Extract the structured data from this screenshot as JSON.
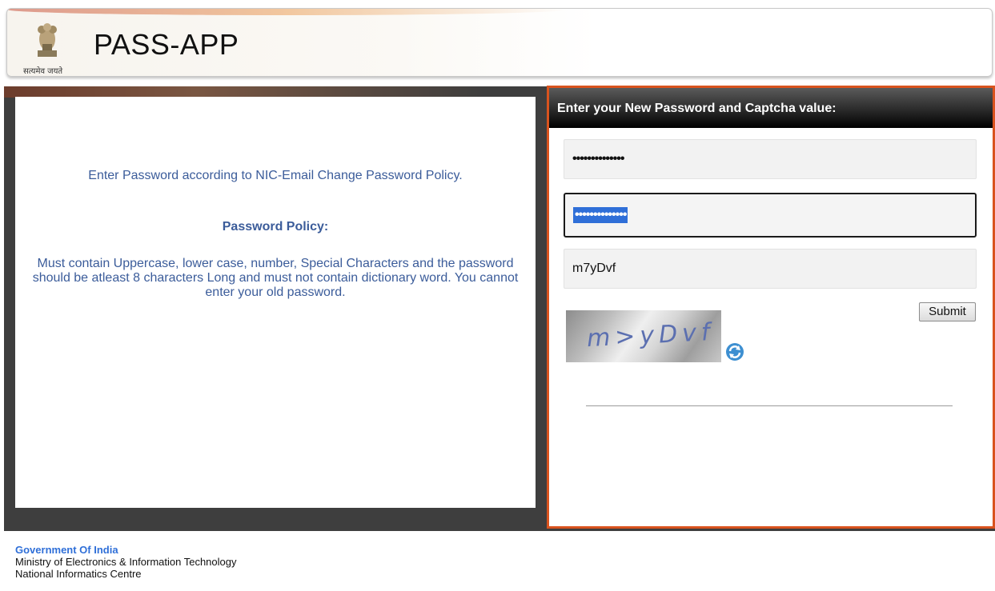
{
  "header": {
    "title": "PASS-APP",
    "emblem_caption": "सत्यमेव जयते"
  },
  "info": {
    "intro": "Enter Password according to NIC-Email Change Password Policy.",
    "policy_heading": "Password Policy:",
    "policy_text": "Must contain Uppercase, lower case, number, Special Characters and the password should be atleast 8 characters Long and must not contain dictionary word. You cannot enter your old password."
  },
  "form": {
    "heading": "Enter your New Password and Captcha value:",
    "new_password_value": "••••••••••••••",
    "confirm_password_value": "••••••••••••••",
    "captcha_value": "m7yDvf",
    "submit_label": "Submit",
    "captcha_image_text": "m>yDvf"
  },
  "footer": {
    "org": "Government Of India",
    "ministry": "Ministry of Electronics & Information Technology",
    "centre": "National Informatics Centre"
  },
  "colors": {
    "accent_border": "#d9531e",
    "info_text": "#3b5c9a",
    "footer_link": "#2f6fd8"
  }
}
